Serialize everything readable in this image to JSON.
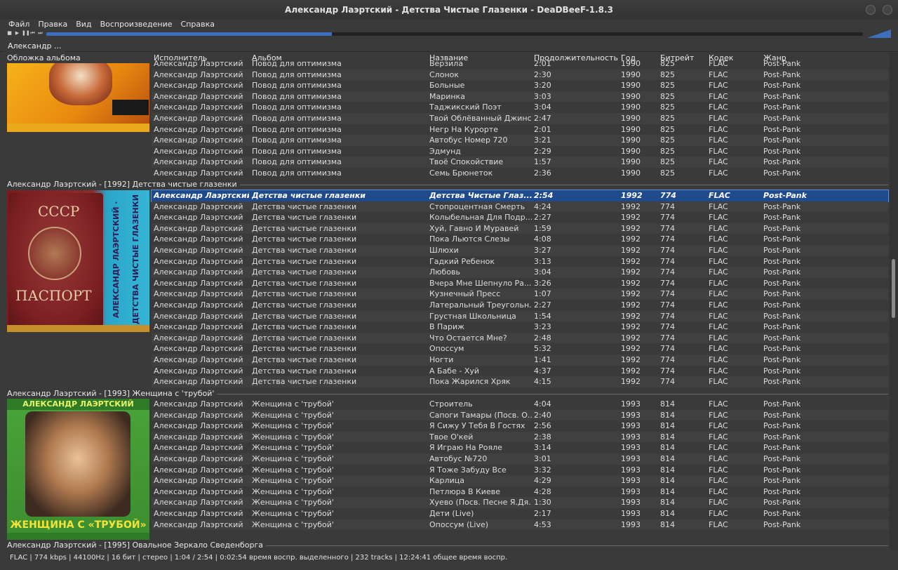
{
  "window": {
    "title": "Александр Лаэртский - Детства Чистые Глазенки - DeaDBeeF-1.8.3"
  },
  "menu": [
    "Файл",
    "Правка",
    "Вид",
    "Воспроизведение",
    "Справка"
  ],
  "toolbar": {
    "icons": [
      "stop-icon",
      "play-icon",
      "pause-icon",
      "previous-icon",
      "next-icon"
    ],
    "glyphs": [
      "■",
      "▶",
      "❚❚",
      "⏮",
      "⏭"
    ],
    "seek_fraction": 0.35,
    "accent": "#3d6fbe"
  },
  "tab": {
    "label": "Александр ..."
  },
  "headers": {
    "cover": "Обложка альбома",
    "artist": "Исполнитель",
    "album": "Альбом",
    "title": "Название",
    "duration": "Продолжительность",
    "year": "Год",
    "bitrate": "Битрейт",
    "codec": "Кодек",
    "genre": "Жанр"
  },
  "groups": [
    {
      "title": "",
      "tracks": [
        [
          "Александр Лаэртский",
          "Повод для оптимизма",
          "Верзила",
          "2:01",
          "1990",
          "825",
          "FLAC",
          "Post-Pank"
        ],
        [
          "Александр Лаэртский",
          "Повод для оптимизма",
          "Слонок",
          "2:30",
          "1990",
          "825",
          "FLAC",
          "Post-Pank"
        ],
        [
          "Александр Лаэртский",
          "Повод для оптимизма",
          "Больные",
          "3:20",
          "1990",
          "825",
          "FLAC",
          "Post-Pank"
        ],
        [
          "Александр Лаэртский",
          "Повод для оптимизма",
          "Маринка",
          "3:03",
          "1990",
          "825",
          "FLAC",
          "Post-Pank"
        ],
        [
          "Александр Лаэртский",
          "Повод для оптимизма",
          "Таджикский Поэт",
          "3:04",
          "1990",
          "825",
          "FLAC",
          "Post-Pank"
        ],
        [
          "Александр Лаэртский",
          "Повод для оптимизма",
          "Твой Облёванный Джинс",
          "2:47",
          "1990",
          "825",
          "FLAC",
          "Post-Pank"
        ],
        [
          "Александр Лаэртский",
          "Повод для оптимизма",
          "Негр На Курорте",
          "2:01",
          "1990",
          "825",
          "FLAC",
          "Post-Pank"
        ],
        [
          "Александр Лаэртский",
          "Повод для оптимизма",
          "Автобус Номер 720",
          "3:21",
          "1990",
          "825",
          "FLAC",
          "Post-Pank"
        ],
        [
          "Александр Лаэртский",
          "Повод для оптимизма",
          "Эдмунд",
          "2:29",
          "1990",
          "825",
          "FLAC",
          "Post-Pank"
        ],
        [
          "Александр Лаэртский",
          "Повод для оптимизма",
          "Твоё Спокойствие",
          "1:57",
          "1990",
          "825",
          "FLAC",
          "Post-Pank"
        ],
        [
          "Александр Лаэртский",
          "Повод для оптимизма",
          "Семь Брюнеток",
          "2:36",
          "1990",
          "825",
          "FLAC",
          "Post-Pank"
        ]
      ]
    },
    {
      "title": "Александр Лаэртский - [1992] Детства чистые глазенки",
      "selected_index": 0,
      "tracks": [
        [
          "Александр Лаэртский",
          "Детства чистые глазенки",
          "Детства Чистые Глаз...",
          "2:54",
          "1992",
          "774",
          "FLAC",
          "Post-Pank"
        ],
        [
          "Александр Лаэртский",
          "Детства чистые глазенки",
          "Стопроцентная Смерть",
          "4:24",
          "1992",
          "774",
          "FLAC",
          "Post-Pank"
        ],
        [
          "Александр Лаэртский",
          "Детства чистые глазенки",
          "Колыбельная Для Подр...",
          "2:27",
          "1992",
          "774",
          "FLAC",
          "Post-Pank"
        ],
        [
          "Александр Лаэртский",
          "Детства чистые глазенки",
          "Хуй, Гавно И Муравей",
          "1:59",
          "1992",
          "774",
          "FLAC",
          "Post-Pank"
        ],
        [
          "Александр Лаэртский",
          "Детства чистые глазенки",
          "Пока Льются Слезы",
          "4:08",
          "1992",
          "774",
          "FLAC",
          "Post-Pank"
        ],
        [
          "Александр Лаэртский",
          "Детства чистые глазенки",
          "Шлюхи",
          "3:27",
          "1992",
          "774",
          "FLAC",
          "Post-Pank"
        ],
        [
          "Александр Лаэртский",
          "Детства чистые глазенки",
          "Гадкий Ребенок",
          "3:13",
          "1992",
          "774",
          "FLAC",
          "Post-Pank"
        ],
        [
          "Александр Лаэртский",
          "Детства чистые глазенки",
          "Любовь",
          "3:04",
          "1992",
          "774",
          "FLAC",
          "Post-Pank"
        ],
        [
          "Александр Лаэртский",
          "Детства чистые глазенки",
          "Вчера Мне Шепнуло Ра...",
          "3:26",
          "1992",
          "774",
          "FLAC",
          "Post-Pank"
        ],
        [
          "Александр Лаэртский",
          "Детства чистые глазенки",
          "Кузнечный Пресс",
          "1:07",
          "1992",
          "774",
          "FLAC",
          "Post-Pank"
        ],
        [
          "Александр Лаэртский",
          "Детства чистые глазенки",
          "Латеральный Треугольн...",
          "2:27",
          "1992",
          "774",
          "FLAC",
          "Post-Pank"
        ],
        [
          "Александр Лаэртский",
          "Детства чистые глазенки",
          "Грустная Школьница",
          "1:54",
          "1992",
          "774",
          "FLAC",
          "Post-Pank"
        ],
        [
          "Александр Лаэртский",
          "Детства чистые глазенки",
          "В Париж",
          "3:23",
          "1992",
          "774",
          "FLAC",
          "Post-Pank"
        ],
        [
          "Александр Лаэртский",
          "Детства чистые глазенки",
          "Что Остается Мне?",
          "2:48",
          "1992",
          "774",
          "FLAC",
          "Post-Pank"
        ],
        [
          "Александр Лаэртский",
          "Детства чистые глазенки",
          "Опоссум",
          "5:32",
          "1992",
          "774",
          "FLAC",
          "Post-Pank"
        ],
        [
          "Александр Лаэртский",
          "Детства чистые глазенки",
          "Ногти",
          "1:41",
          "1992",
          "774",
          "FLAC",
          "Post-Pank"
        ],
        [
          "Александр Лаэртский",
          "Детства чистые глазенки",
          "А Бабе - Хуй",
          "4:37",
          "1992",
          "774",
          "FLAC",
          "Post-Pank"
        ],
        [
          "Александр Лаэртский",
          "Детства чистые глазенки",
          "Пока Жарился Хряк",
          "4:15",
          "1992",
          "774",
          "FLAC",
          "Post-Pank"
        ]
      ]
    },
    {
      "title": "Александр Лаэртский - [1993] Женщина с 'трубой'",
      "tracks": [
        [
          "Александр Лаэртский",
          "Женщина с 'трубой'",
          "Строитель",
          "4:04",
          "1993",
          "814",
          "FLAC",
          "Post-Pank"
        ],
        [
          "Александр Лаэртский",
          "Женщина с 'трубой'",
          "Сапоги Тамары (Посв. О...",
          "2:40",
          "1993",
          "814",
          "FLAC",
          "Post-Pank"
        ],
        [
          "Александр Лаэртский",
          "Женщина с 'трубой'",
          "Я Сижу У Тебя В Гостях",
          "2:56",
          "1993",
          "814",
          "FLAC",
          "Post-Pank"
        ],
        [
          "Александр Лаэртский",
          "Женщина с 'трубой'",
          "Твое О'кей",
          "2:38",
          "1993",
          "814",
          "FLAC",
          "Post-Pank"
        ],
        [
          "Александр Лаэртский",
          "Женщина с 'трубой'",
          "Я Играю На Рояле",
          "3:14",
          "1993",
          "814",
          "FLAC",
          "Post-Pank"
        ],
        [
          "Александр Лаэртский",
          "Женщина с 'трубой'",
          "Автобус №720",
          "3:01",
          "1993",
          "814",
          "FLAC",
          "Post-Pank"
        ],
        [
          "Александр Лаэртский",
          "Женщина с 'трубой'",
          "Я Тоже Забуду Все",
          "3:32",
          "1993",
          "814",
          "FLAC",
          "Post-Pank"
        ],
        [
          "Александр Лаэртский",
          "Женщина с 'трубой'",
          "Карлица",
          "4:29",
          "1993",
          "814",
          "FLAC",
          "Post-Pank"
        ],
        [
          "Александр Лаэртский",
          "Женщина с 'трубой'",
          "Петлюра В Киеве",
          "4:28",
          "1993",
          "814",
          "FLAC",
          "Post-Pank"
        ],
        [
          "Александр Лаэртский",
          "Женщина с 'трубой'",
          "Хуево (Посв. Песне Я.Дя...",
          "1:30",
          "1993",
          "814",
          "FLAC",
          "Post-Pank"
        ],
        [
          "Александр Лаэртский",
          "Женщина с 'трубой'",
          "Дети (Live)",
          "2:17",
          "1993",
          "814",
          "FLAC",
          "Post-Pank"
        ],
        [
          "Александр Лаэртский",
          "Женщина с 'трубой'",
          "Опоссум (Live)",
          "4:53",
          "1993",
          "814",
          "FLAC",
          "Post-Pank"
        ]
      ]
    },
    {
      "title": "Александр Лаэртский - [1995] Овальное Зеркало Сведенборга",
      "tracks": []
    }
  ],
  "covers": {
    "cover2_title_top": "СССР",
    "cover2_title_bottom": "ПАСПОРТ",
    "cover2_side": "АЛЕКСАНДР ЛАЭРТСКИЙ · ДЕТСТВА ЧИСТЫЕ ГЛАЗЕНКИ",
    "cover3_top": "АЛЕКСАНДР ЛАЭРТСКИЙ",
    "cover3_bottom": "ЖЕНЩИНА С «ТРУБОЙ»"
  },
  "status": "FLAC | 774 kbps | 44100Hz | 16 бит | стерео | 1:04 / 2:54 | 0:02:54 время воспр. выделенного | 232 tracks | 12:24:41 общее время воспр."
}
